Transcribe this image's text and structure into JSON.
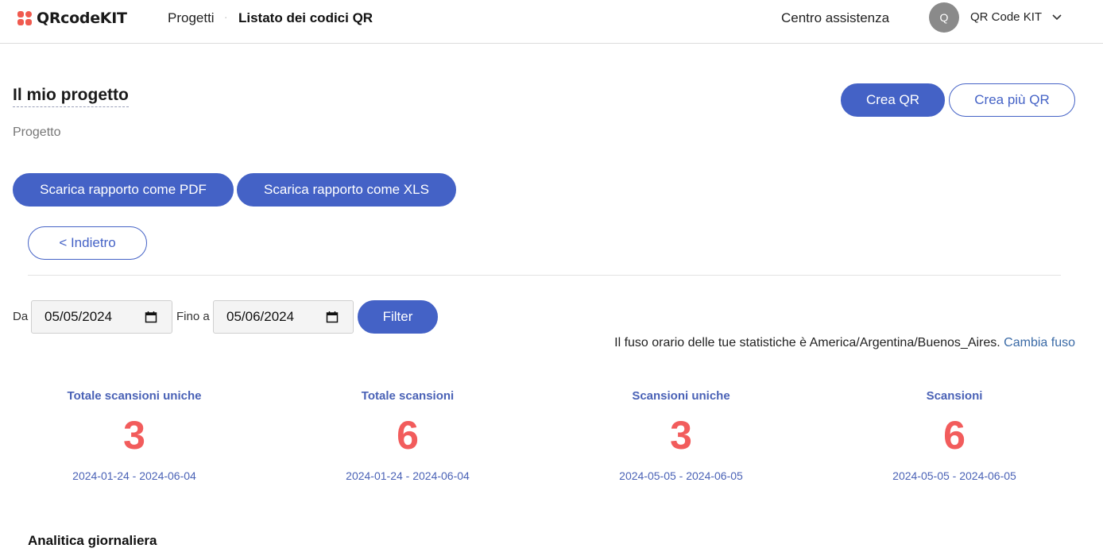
{
  "header": {
    "logo_text": "QRcodeKIT",
    "breadcrumb": [
      "Progetti",
      "Listato dei codici QR"
    ],
    "breadcrumb_sep": "·",
    "help_link": "Centro assistenza",
    "avatar_initial": "Q",
    "username": "QR Code KIT"
  },
  "project": {
    "title": "Il mio progetto",
    "subtitle": "Progetto"
  },
  "actions": {
    "create_qr": "Crea QR",
    "create_many_qr": "Crea più QR",
    "download_pdf": "Scarica rapporto come PDF",
    "download_xls": "Scarica rapporto come XLS",
    "back": "< Indietro"
  },
  "filters": {
    "from_label": "Da",
    "from_value": "05/05/2024",
    "to_label": "Fino a",
    "to_value": "05/06/2024",
    "filter_button": "Filter"
  },
  "timezone": {
    "text": "Il fuso orario delle tue statistiche è America/Argentina/Buenos_Aires.",
    "change_link": "Cambia fuso"
  },
  "stats": [
    {
      "label": "Totale scansioni uniche",
      "value": "3",
      "range": "2024-01-24 - 2024-06-04"
    },
    {
      "label": "Totale scansioni",
      "value": "6",
      "range": "2024-01-24 - 2024-06-04"
    },
    {
      "label": "Scansioni uniche",
      "value": "3",
      "range": "2024-05-05 - 2024-06-05"
    },
    {
      "label": "Scansioni",
      "value": "6",
      "range": "2024-05-05 - 2024-06-05"
    }
  ],
  "sections": {
    "daily_analytics": "Analitica giornaliera"
  },
  "colors": {
    "primary": "#4462c6",
    "stat_value": "#f25c5c",
    "stat_label": "#4a62b6",
    "logo_accent": "#f05a4f"
  }
}
